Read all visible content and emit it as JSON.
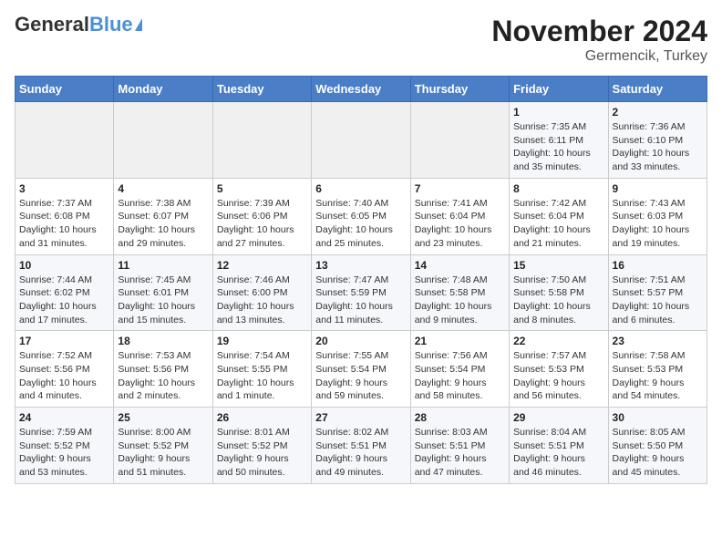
{
  "header": {
    "logo_general": "General",
    "logo_blue": "Blue",
    "title": "November 2024",
    "subtitle": "Germencik, Turkey"
  },
  "days_of_week": [
    "Sunday",
    "Monday",
    "Tuesday",
    "Wednesday",
    "Thursday",
    "Friday",
    "Saturday"
  ],
  "weeks": [
    [
      {
        "day": "",
        "info": ""
      },
      {
        "day": "",
        "info": ""
      },
      {
        "day": "",
        "info": ""
      },
      {
        "day": "",
        "info": ""
      },
      {
        "day": "",
        "info": ""
      },
      {
        "day": "1",
        "info": "Sunrise: 7:35 AM\nSunset: 6:11 PM\nDaylight: 10 hours\nand 35 minutes."
      },
      {
        "day": "2",
        "info": "Sunrise: 7:36 AM\nSunset: 6:10 PM\nDaylight: 10 hours\nand 33 minutes."
      }
    ],
    [
      {
        "day": "3",
        "info": "Sunrise: 7:37 AM\nSunset: 6:08 PM\nDaylight: 10 hours\nand 31 minutes."
      },
      {
        "day": "4",
        "info": "Sunrise: 7:38 AM\nSunset: 6:07 PM\nDaylight: 10 hours\nand 29 minutes."
      },
      {
        "day": "5",
        "info": "Sunrise: 7:39 AM\nSunset: 6:06 PM\nDaylight: 10 hours\nand 27 minutes."
      },
      {
        "day": "6",
        "info": "Sunrise: 7:40 AM\nSunset: 6:05 PM\nDaylight: 10 hours\nand 25 minutes."
      },
      {
        "day": "7",
        "info": "Sunrise: 7:41 AM\nSunset: 6:04 PM\nDaylight: 10 hours\nand 23 minutes."
      },
      {
        "day": "8",
        "info": "Sunrise: 7:42 AM\nSunset: 6:04 PM\nDaylight: 10 hours\nand 21 minutes."
      },
      {
        "day": "9",
        "info": "Sunrise: 7:43 AM\nSunset: 6:03 PM\nDaylight: 10 hours\nand 19 minutes."
      }
    ],
    [
      {
        "day": "10",
        "info": "Sunrise: 7:44 AM\nSunset: 6:02 PM\nDaylight: 10 hours\nand 17 minutes."
      },
      {
        "day": "11",
        "info": "Sunrise: 7:45 AM\nSunset: 6:01 PM\nDaylight: 10 hours\nand 15 minutes."
      },
      {
        "day": "12",
        "info": "Sunrise: 7:46 AM\nSunset: 6:00 PM\nDaylight: 10 hours\nand 13 minutes."
      },
      {
        "day": "13",
        "info": "Sunrise: 7:47 AM\nSunset: 5:59 PM\nDaylight: 10 hours\nand 11 minutes."
      },
      {
        "day": "14",
        "info": "Sunrise: 7:48 AM\nSunset: 5:58 PM\nDaylight: 10 hours\nand 9 minutes."
      },
      {
        "day": "15",
        "info": "Sunrise: 7:50 AM\nSunset: 5:58 PM\nDaylight: 10 hours\nand 8 minutes."
      },
      {
        "day": "16",
        "info": "Sunrise: 7:51 AM\nSunset: 5:57 PM\nDaylight: 10 hours\nand 6 minutes."
      }
    ],
    [
      {
        "day": "17",
        "info": "Sunrise: 7:52 AM\nSunset: 5:56 PM\nDaylight: 10 hours\nand 4 minutes."
      },
      {
        "day": "18",
        "info": "Sunrise: 7:53 AM\nSunset: 5:56 PM\nDaylight: 10 hours\nand 2 minutes."
      },
      {
        "day": "19",
        "info": "Sunrise: 7:54 AM\nSunset: 5:55 PM\nDaylight: 10 hours\nand 1 minute."
      },
      {
        "day": "20",
        "info": "Sunrise: 7:55 AM\nSunset: 5:54 PM\nDaylight: 9 hours\nand 59 minutes."
      },
      {
        "day": "21",
        "info": "Sunrise: 7:56 AM\nSunset: 5:54 PM\nDaylight: 9 hours\nand 58 minutes."
      },
      {
        "day": "22",
        "info": "Sunrise: 7:57 AM\nSunset: 5:53 PM\nDaylight: 9 hours\nand 56 minutes."
      },
      {
        "day": "23",
        "info": "Sunrise: 7:58 AM\nSunset: 5:53 PM\nDaylight: 9 hours\nand 54 minutes."
      }
    ],
    [
      {
        "day": "24",
        "info": "Sunrise: 7:59 AM\nSunset: 5:52 PM\nDaylight: 9 hours\nand 53 minutes."
      },
      {
        "day": "25",
        "info": "Sunrise: 8:00 AM\nSunset: 5:52 PM\nDaylight: 9 hours\nand 51 minutes."
      },
      {
        "day": "26",
        "info": "Sunrise: 8:01 AM\nSunset: 5:52 PM\nDaylight: 9 hours\nand 50 minutes."
      },
      {
        "day": "27",
        "info": "Sunrise: 8:02 AM\nSunset: 5:51 PM\nDaylight: 9 hours\nand 49 minutes."
      },
      {
        "day": "28",
        "info": "Sunrise: 8:03 AM\nSunset: 5:51 PM\nDaylight: 9 hours\nand 47 minutes."
      },
      {
        "day": "29",
        "info": "Sunrise: 8:04 AM\nSunset: 5:51 PM\nDaylight: 9 hours\nand 46 minutes."
      },
      {
        "day": "30",
        "info": "Sunrise: 8:05 AM\nSunset: 5:50 PM\nDaylight: 9 hours\nand 45 minutes."
      }
    ]
  ]
}
